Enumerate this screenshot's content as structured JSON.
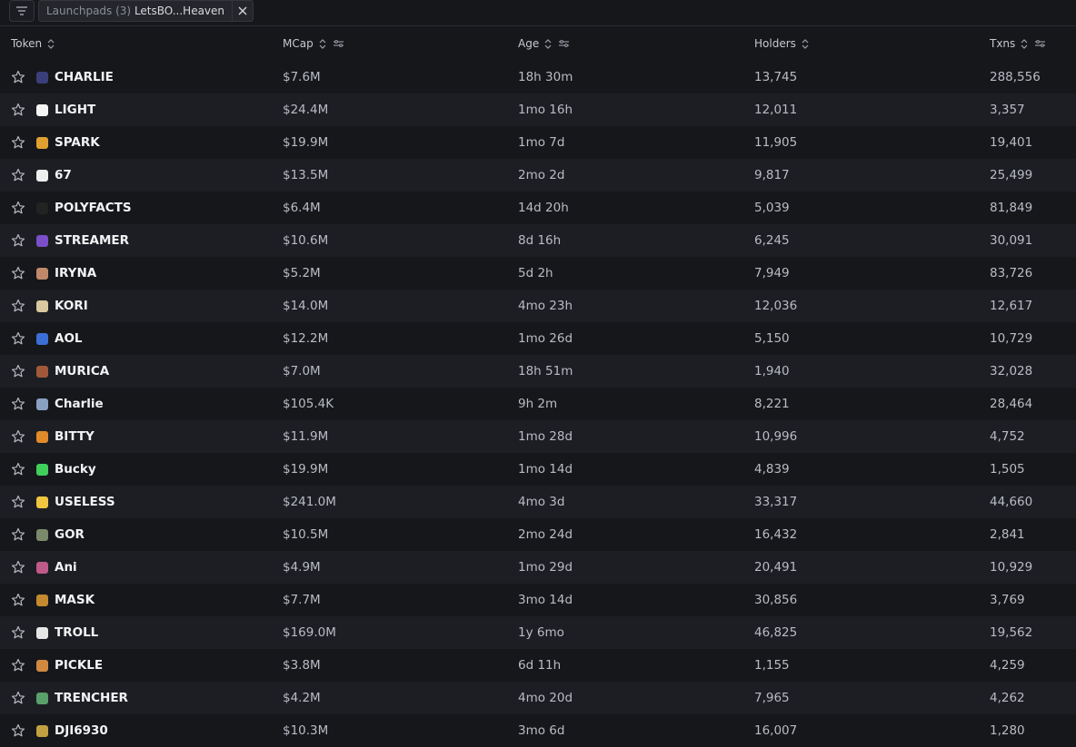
{
  "filter_bar": {
    "filter_icon": "filter-lines-icon",
    "chip_label": "Launchpads (3)",
    "chip_value": "LetsBO...Heaven",
    "chip_close_icon": "close-icon"
  },
  "columns": [
    {
      "label": "Token",
      "sortable": true,
      "filterable": false
    },
    {
      "label": "MCap",
      "sortable": true,
      "filterable": true
    },
    {
      "label": "Age",
      "sortable": true,
      "filterable": true
    },
    {
      "label": "Holders",
      "sortable": true,
      "filterable": false
    },
    {
      "label": "Txns",
      "sortable": true,
      "filterable": true
    }
  ],
  "colors": {
    "background": "#16171b",
    "row_alt": "#1d1e23",
    "text_primary": "#f2f3f5",
    "text_secondary": "#b9bcc4"
  },
  "rows": [
    {
      "name": "CHARLIE",
      "mcap": "$7.6M",
      "age": "18h 30m",
      "holders": "13,745",
      "txns": "288,556",
      "icon_color": "#3a3f7a"
    },
    {
      "name": "LIGHT",
      "mcap": "$24.4M",
      "age": "1mo 16h",
      "holders": "12,011",
      "txns": "3,357",
      "icon_color": "#f5f5f5"
    },
    {
      "name": "SPARK",
      "mcap": "$19.9M",
      "age": "1mo 7d",
      "holders": "11,905",
      "txns": "19,401",
      "icon_color": "#e0a030"
    },
    {
      "name": "67",
      "mcap": "$13.5M",
      "age": "2mo 2d",
      "holders": "9,817",
      "txns": "25,499",
      "icon_color": "#eeeeee"
    },
    {
      "name": "POLYFACTS",
      "mcap": "$6.4M",
      "age": "14d 20h",
      "holders": "5,039",
      "txns": "81,849",
      "icon_color": "#222222"
    },
    {
      "name": "STREAMER",
      "mcap": "$10.6M",
      "age": "8d 16h",
      "holders": "6,245",
      "txns": "30,091",
      "icon_color": "#7a4fc9"
    },
    {
      "name": "IRYNA",
      "mcap": "$5.2M",
      "age": "5d 2h",
      "holders": "7,949",
      "txns": "83,726",
      "icon_color": "#c08a6a"
    },
    {
      "name": "KORI",
      "mcap": "$14.0M",
      "age": "4mo 23h",
      "holders": "12,036",
      "txns": "12,617",
      "icon_color": "#d8c9a0"
    },
    {
      "name": "AOL",
      "mcap": "$12.2M",
      "age": "1mo 26d",
      "holders": "5,150",
      "txns": "10,729",
      "icon_color": "#3b6fd4"
    },
    {
      "name": "MURICA",
      "mcap": "$7.0M",
      "age": "18h 51m",
      "holders": "1,940",
      "txns": "32,028",
      "icon_color": "#a0583a"
    },
    {
      "name": "Charlie",
      "mcap": "$105.4K",
      "age": "9h 2m",
      "holders": "8,221",
      "txns": "28,464",
      "icon_color": "#8aa0c0"
    },
    {
      "name": "BITTY",
      "mcap": "$11.9M",
      "age": "1mo 28d",
      "holders": "10,996",
      "txns": "4,752",
      "icon_color": "#e08a2a"
    },
    {
      "name": "Bucky",
      "mcap": "$19.9M",
      "age": "1mo 14d",
      "holders": "4,839",
      "txns": "1,505",
      "icon_color": "#3fcf5a"
    },
    {
      "name": "USELESS",
      "mcap": "$241.0M",
      "age": "4mo 3d",
      "holders": "33,317",
      "txns": "44,660",
      "icon_color": "#f0c640"
    },
    {
      "name": "GOR",
      "mcap": "$10.5M",
      "age": "2mo 24d",
      "holders": "16,432",
      "txns": "2,841",
      "icon_color": "#7a8a6a"
    },
    {
      "name": "Ani",
      "mcap": "$4.9M",
      "age": "1mo 29d",
      "holders": "20,491",
      "txns": "10,929",
      "icon_color": "#c05a8a"
    },
    {
      "name": "MASK",
      "mcap": "$7.7M",
      "age": "3mo 14d",
      "holders": "30,856",
      "txns": "3,769",
      "icon_color": "#c58a30"
    },
    {
      "name": "TROLL",
      "mcap": "$169.0M",
      "age": "1y 6mo",
      "holders": "46,825",
      "txns": "19,562",
      "icon_color": "#e6e6e6"
    },
    {
      "name": "PICKLE",
      "mcap": "$3.8M",
      "age": "6d 11h",
      "holders": "1,155",
      "txns": "4,259",
      "icon_color": "#d08a40"
    },
    {
      "name": "TRENCHER",
      "mcap": "$4.2M",
      "age": "4mo 20d",
      "holders": "7,965",
      "txns": "4,262",
      "icon_color": "#5aa06a"
    },
    {
      "name": "DJI6930",
      "mcap": "$10.3M",
      "age": "3mo 6d",
      "holders": "16,007",
      "txns": "1,280",
      "icon_color": "#c0a040"
    }
  ]
}
